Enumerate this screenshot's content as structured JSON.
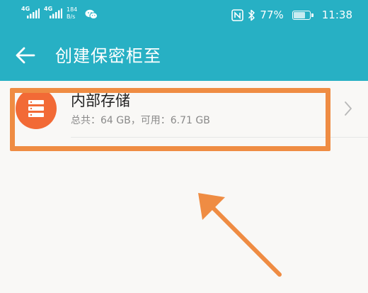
{
  "status_bar": {
    "sim1_network": "4G",
    "sim2_network": "4G",
    "speed_value": "184",
    "speed_unit": "B/s",
    "battery_percent": "77%",
    "battery_level": 0.77,
    "time": "11:38",
    "icons": [
      "signal-icon",
      "wechat-icon",
      "nfc-icon",
      "bluetooth-icon",
      "battery-icon"
    ]
  },
  "toolbar": {
    "title": "创建保密柜至",
    "back_icon": "back-arrow-icon"
  },
  "storage": {
    "name": "内部存储",
    "detail": "总共：64 GB，可用：6.71 GB",
    "icon": "storage-icon",
    "chevron_icon": "chevron-right-icon"
  },
  "colors": {
    "header": "#27b0c4",
    "storage_icon_bg": "#f26a36",
    "annotation": "#ef8c43",
    "background": "#f9f8f6"
  }
}
